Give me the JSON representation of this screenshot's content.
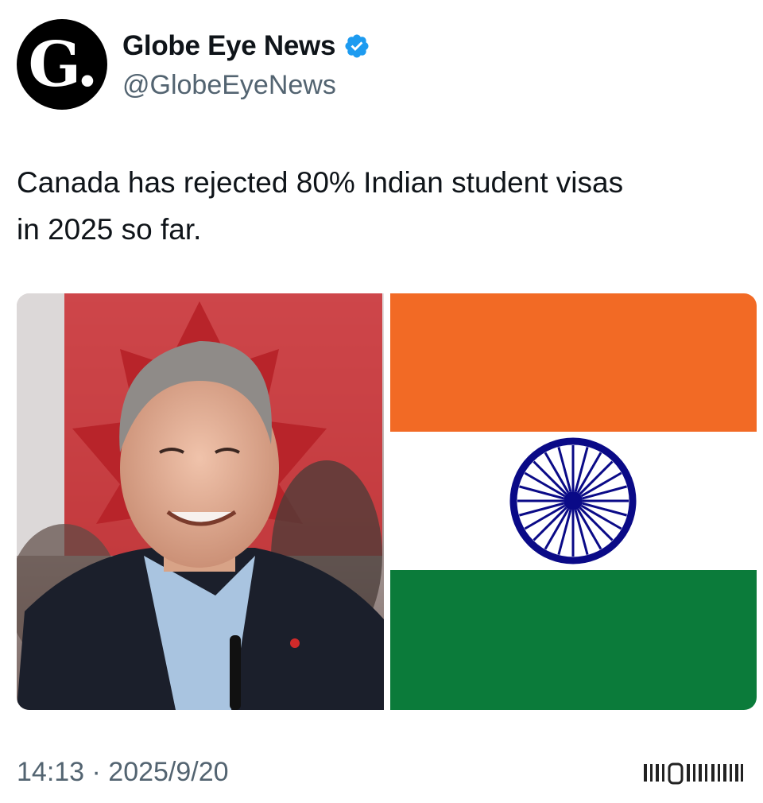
{
  "author": {
    "avatar_letter": "G.",
    "display_name": "Globe Eye News",
    "handle": "@GlobeEyeNews",
    "verified": true,
    "verified_color": "#1d9bf0"
  },
  "tweet": {
    "text_line1": "Canada has rejected 80% Indian student visas",
    "text_line2": "in 2025 so far."
  },
  "media": {
    "photo_description_icon": "person-portrait",
    "flag": {
      "saffron": "#f26a25",
      "white": "#ffffff",
      "green": "#0b7b3a",
      "chakra": "#0a0a87"
    }
  },
  "footer": {
    "timestamp": "14:13 · 2025/9/20"
  }
}
